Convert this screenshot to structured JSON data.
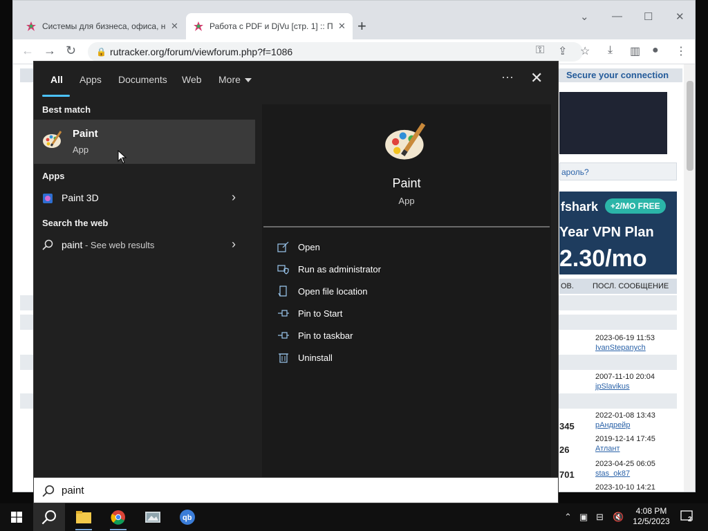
{
  "browser": {
    "tabs": [
      {
        "title": "Системы для бизнеса, офиса, н",
        "close": "✕"
      },
      {
        "title": "Работа с PDF и DjVu [стр. 1] :: П",
        "close": "✕"
      }
    ],
    "new_tab": "+",
    "url": "rutracker.org/forum/viewforum.php?f=1086",
    "window": {
      "minimize": "—",
      "maximize": "☐",
      "close": "✕",
      "tab_search": "⌄"
    }
  },
  "page": {
    "secure_banner": "Secure your connection",
    "login_hint": "ароль?",
    "ad": {
      "brand": "fshark",
      "badge": "+2/MO FREE",
      "plan": "Year VPN Plan",
      "price": "2.30/mo"
    },
    "column_header_left": "ОВ.",
    "column_header": "ПОСЛ. СООБЩЕНИЕ",
    "posts": [
      {
        "num": "",
        "date": "2023-06-19 11:53",
        "author": "IvanStepanych"
      },
      {
        "num": "",
        "date": "2007-11-10 20:04",
        "author": "jpSlavikus"
      },
      {
        "num": "345",
        "date": "2022-01-08 13:43",
        "author": "рАндрейр"
      },
      {
        "num": "26",
        "date": "2019-12-14 17:45",
        "author": "Атлант"
      },
      {
        "num": "701",
        "date": "2023-04-25 06:05",
        "author": "stas_ok87"
      },
      {
        "num": "",
        "date": "2023-10-10 14:21",
        "author": ""
      }
    ]
  },
  "start": {
    "filters": [
      "All",
      "Apps",
      "Documents",
      "Web",
      "More"
    ],
    "active_filter": "All",
    "ellipsis": "···",
    "close": "✕",
    "best_match_heading": "Best match",
    "best_match": {
      "name": "Paint",
      "type": "App"
    },
    "apps_heading": "Apps",
    "apps": [
      {
        "name": "Paint 3D"
      }
    ],
    "web_heading": "Search the web",
    "web": {
      "query": "paint",
      "suffix": " - See web results"
    },
    "preview": {
      "name": "Paint",
      "type": "App",
      "actions": [
        {
          "label": "Open",
          "icon": "open-icon"
        },
        {
          "label": "Run as administrator",
          "icon": "shield-icon"
        },
        {
          "label": "Open file location",
          "icon": "folder-location-icon"
        },
        {
          "label": "Pin to Start",
          "icon": "pin-icon"
        },
        {
          "label": "Pin to taskbar",
          "icon": "pin-icon"
        },
        {
          "label": "Uninstall",
          "icon": "trash-icon"
        }
      ]
    },
    "search_value": "paint"
  },
  "taskbar": {
    "time": "4:08 PM",
    "date": "12/5/2023",
    "notifications": "2",
    "apps": [
      "file-explorer",
      "chrome",
      "paint-app",
      "qbittorrent"
    ]
  },
  "colors": {
    "accent": "#4cc2ff",
    "menu_bg": "#202020",
    "selected": "#3a3a3a"
  }
}
